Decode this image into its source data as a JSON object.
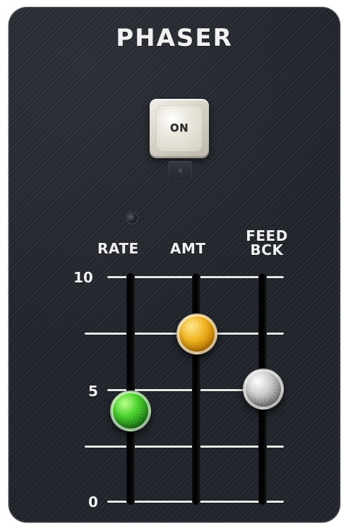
{
  "panel": {
    "title": "PHASER",
    "on_button": {
      "label": "ON"
    },
    "labels": {
      "rate": "RATE",
      "amt": "AMT",
      "feedback_line1": "FEED",
      "feedback_line2": "BCK"
    },
    "scale": {
      "top": "10",
      "mid": "5",
      "bottom": "0"
    },
    "sliders": {
      "rate": {
        "value": 4.0,
        "color": "#3FBF2D"
      },
      "amt": {
        "value": 7.5,
        "color": "#F2B524"
      },
      "feedback": {
        "value": 5.0,
        "color": "#BFBFBF"
      }
    },
    "leds": {
      "rate_indicator": {
        "color": "#1A1D22"
      }
    }
  }
}
